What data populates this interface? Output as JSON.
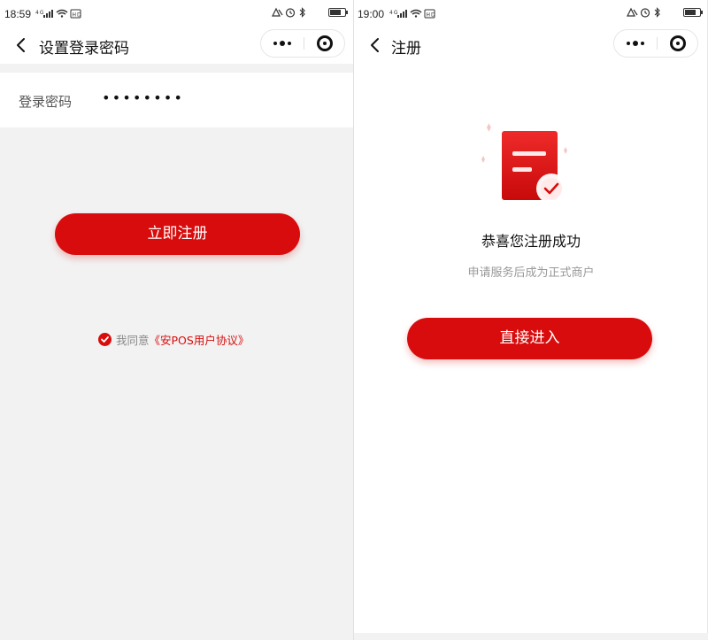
{
  "colors": {
    "accent": "#d80c0c",
    "page_bg": "#f2f2f2"
  },
  "left": {
    "status": {
      "time": "18:59",
      "signal_text": "4G",
      "hd": "HD"
    },
    "nav": {
      "title": "设置登录密码"
    },
    "form": {
      "password_label": "登录密码",
      "password_value": "••••••••"
    },
    "register_button": "立即注册",
    "agreement": {
      "prefix": "我同意",
      "link": "《安POS用户协议》",
      "checked": true
    }
  },
  "right": {
    "status": {
      "time": "19:00",
      "signal_text": "4G",
      "hd": "HD"
    },
    "nav": {
      "title": "注册"
    },
    "success_title": "恭喜您注册成功",
    "success_subtitle": "申请服务后成为正式商户",
    "enter_button": "直接进入"
  }
}
